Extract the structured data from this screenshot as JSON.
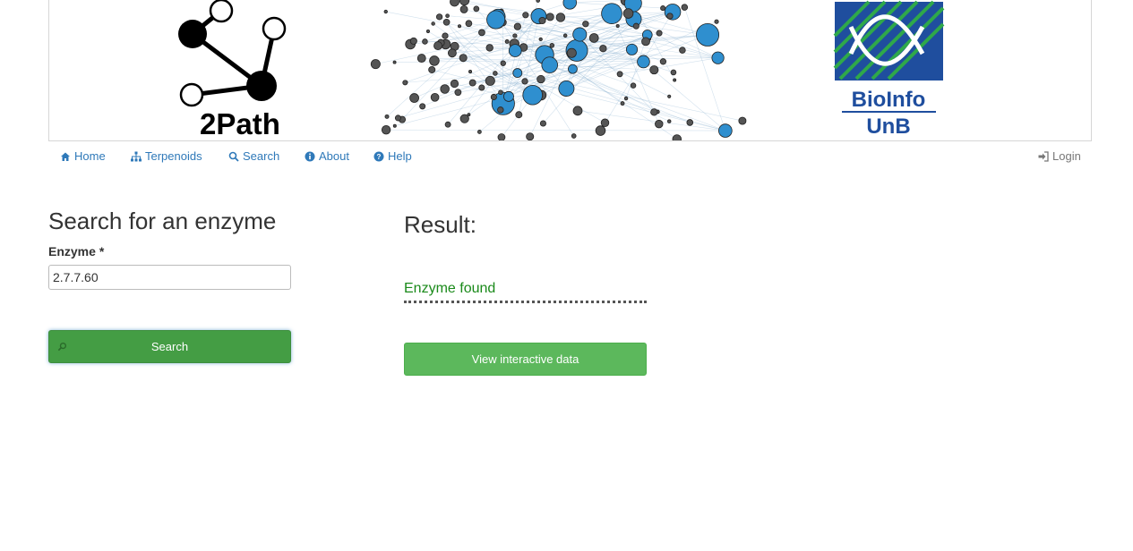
{
  "banner": {
    "logo_text": "2Path",
    "institution_lines": [
      "BioInfo",
      "UnB"
    ]
  },
  "nav": {
    "items": [
      {
        "label": "Home",
        "icon": "home-icon"
      },
      {
        "label": "Terpenoids",
        "icon": "sitemap-icon"
      },
      {
        "label": "Search",
        "icon": "search-icon"
      },
      {
        "label": "About",
        "icon": "info-circle-icon"
      },
      {
        "label": "Help",
        "icon": "question-circle-icon"
      }
    ],
    "login": {
      "label": "Login",
      "icon": "sign-in-icon"
    }
  },
  "search_form": {
    "title": "Search for an enzyme",
    "label": "Enzyme",
    "required_marker": "*",
    "value": "2.7.7.60",
    "button_label": "Search"
  },
  "result": {
    "title": "Result:",
    "status": "Enzyme found",
    "view_button_label": "View interactive data"
  },
  "colors": {
    "link": "#2f79b9",
    "success_dark": "#449d44",
    "success": "#5cb85c",
    "found_text": "#1a8a1a",
    "node_blue": "#2f8fcf",
    "node_gray": "#555555"
  }
}
